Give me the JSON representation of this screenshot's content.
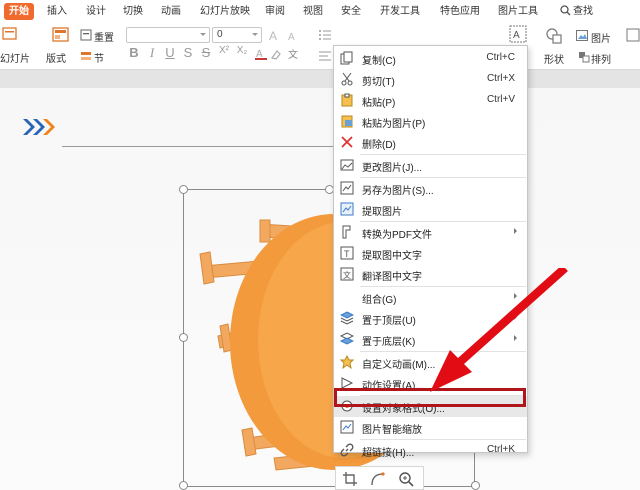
{
  "tabs": [
    "开始",
    "插入",
    "设计",
    "切换",
    "动画",
    "幻灯片放映",
    "审阅",
    "视图",
    "安全",
    "开发工具",
    "特色应用",
    "图片工具",
    "查找"
  ],
  "ribbon": {
    "new_slide": "幻灯片",
    "layout": "版式",
    "reset": "重置",
    "section": "节",
    "font_name": "",
    "font_size": "0",
    "shape": "形状",
    "arrange": "排列",
    "picture": "图片"
  },
  "context_menu": {
    "items": [
      {
        "label": "复制(C)",
        "shortcut": "Ctrl+C",
        "icon": "copy-icon"
      },
      {
        "label": "剪切(T)",
        "shortcut": "Ctrl+X",
        "icon": "cut-icon"
      },
      {
        "label": "粘贴(P)",
        "shortcut": "Ctrl+V",
        "icon": "paste-icon"
      },
      {
        "label": "粘贴为图片(P)",
        "shortcut": "",
        "icon": "paste-picture-icon"
      },
      {
        "label": "删除(D)",
        "shortcut": "",
        "icon": "delete-icon"
      },
      {
        "label": "更改图片(J)...",
        "shortcut": "",
        "icon": "change-picture-icon"
      },
      {
        "label": "另存为图片(S)...",
        "shortcut": "",
        "icon": "save-picture-icon"
      },
      {
        "label": "提取图片",
        "shortcut": "",
        "icon": "extract-picture-icon"
      },
      {
        "label": "转换为PDF文件",
        "shortcut": "",
        "icon": "pdf-icon"
      },
      {
        "label": "提取图中文字",
        "shortcut": "",
        "icon": "extract-text-icon"
      },
      {
        "label": "翻译图中文字",
        "shortcut": "",
        "icon": "translate-icon"
      },
      {
        "label": "组合(G)",
        "shortcut": "",
        "icon": "group-icon"
      },
      {
        "label": "置于顶层(U)",
        "shortcut": "",
        "icon": "bring-front-icon"
      },
      {
        "label": "置于底层(K)",
        "shortcut": "",
        "icon": "send-back-icon"
      },
      {
        "label": "自定义动画(M)...",
        "shortcut": "",
        "icon": "animation-icon"
      },
      {
        "label": "动作设置(A)...",
        "shortcut": "",
        "icon": "action-icon"
      },
      {
        "label": "设置对象格式(O)...",
        "shortcut": "",
        "icon": "format-object-icon"
      },
      {
        "label": "图片智能缩放",
        "shortcut": "",
        "icon": "smart-scale-icon"
      },
      {
        "label": "超链接(H)...",
        "shortcut": "Ctrl+K",
        "icon": "hyperlink-icon"
      }
    ]
  }
}
